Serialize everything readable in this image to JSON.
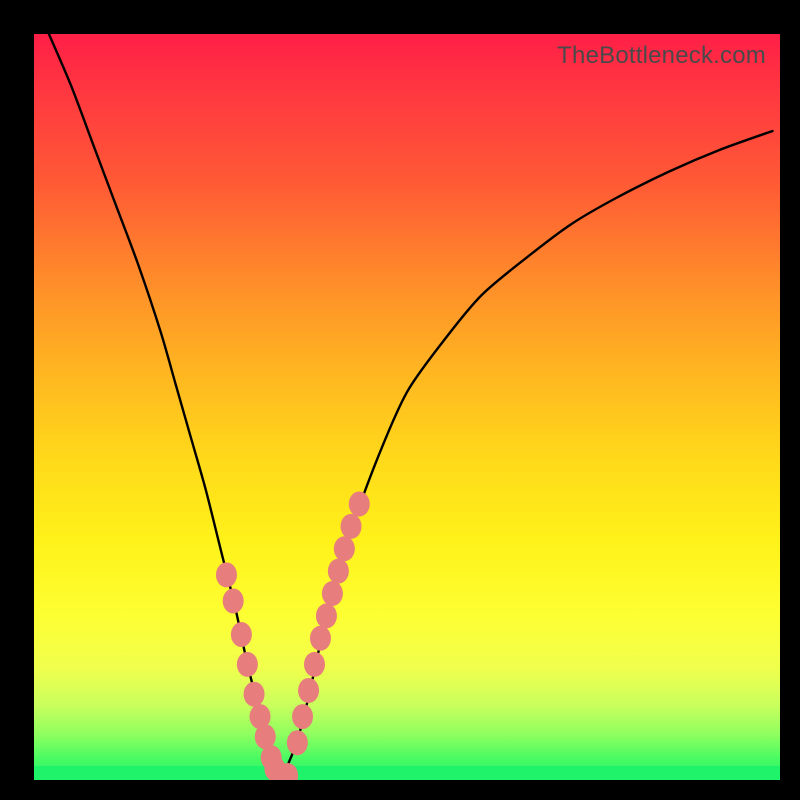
{
  "watermark": "TheBottleneck.com",
  "colors": {
    "frame": "#000000",
    "curve": "#000000",
    "dot_fill": "#e87d7d",
    "dot_stroke": "#d86a6a",
    "gradient_top": "#ff1f47",
    "gradient_bottom": "#1ef36a"
  },
  "chart_data": {
    "type": "line",
    "title": "",
    "xlabel": "",
    "ylabel": "",
    "xlim": [
      0,
      100
    ],
    "ylim": [
      0,
      100
    ],
    "grid": false,
    "legend": false,
    "annotations": [],
    "series": [
      {
        "name": "bottleneck-curve",
        "x": [
          2,
          5,
          8,
          11,
          14,
          17,
          19,
          21,
          23,
          25,
          27,
          28.5,
          30,
          31,
          32,
          33,
          34,
          35.5,
          37,
          39,
          42,
          46,
          50,
          55,
          60,
          66,
          72,
          78,
          85,
          92,
          99
        ],
        "y": [
          100,
          93,
          85,
          77,
          69,
          60,
          53,
          46,
          39,
          31,
          23,
          16,
          10,
          6,
          2,
          0.5,
          2,
          6,
          12,
          21,
          32,
          43,
          52,
          59,
          65,
          70,
          74.5,
          78,
          81.5,
          84.5,
          87
        ]
      }
    ],
    "highlight_dots": {
      "name": "marked-points",
      "x": [
        25.8,
        26.7,
        27.8,
        28.6,
        29.5,
        30.3,
        31.0,
        31.8,
        32.3,
        33.0,
        34.0,
        35.3,
        36.0,
        36.8,
        37.6,
        38.4,
        39.2,
        40.0,
        40.8,
        41.6,
        42.5,
        43.6
      ],
      "y": [
        27.5,
        24.0,
        19.5,
        15.5,
        11.5,
        8.5,
        5.8,
        3.0,
        1.5,
        0.6,
        0.6,
        5.0,
        8.5,
        12.0,
        15.5,
        19.0,
        22.0,
        25.0,
        28.0,
        31.0,
        34.0,
        37.0
      ]
    }
  }
}
